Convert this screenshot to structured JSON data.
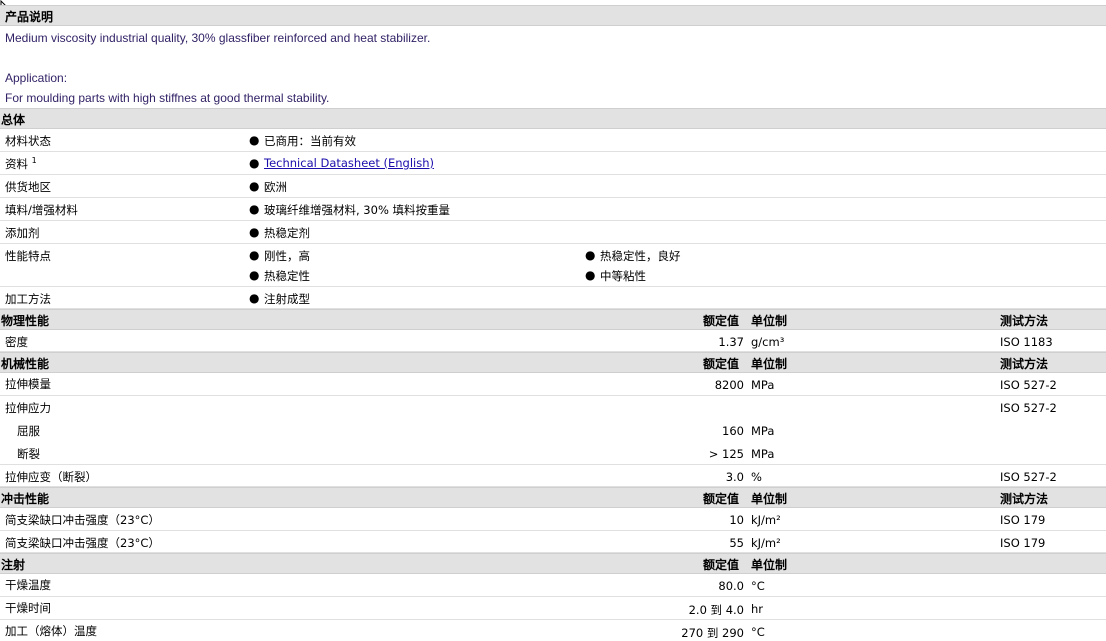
{
  "description": {
    "section_title": "产品说明",
    "line1": "Medium viscosity industrial quality, 30% glassfiber reinforced and heat stabilizer.",
    "line2": "Application:",
    "line3": "For moulding parts with high stiffnes at good thermal stability."
  },
  "general": {
    "section_title": "总体",
    "rows": [
      {
        "label": "材料状态",
        "value": "已商用：当前有效"
      },
      {
        "label": "资料",
        "sup": "1",
        "value": "Technical Datasheet (English)"
      },
      {
        "label": "供货地区",
        "value": "欧洲"
      },
      {
        "label": "填料/增强材料",
        "value": "玻璃纤维增强材料, 30% 填料按重量"
      },
      {
        "label": "添加剂",
        "value": "热稳定剂"
      },
      {
        "label": "性能特点",
        "values": [
          "刚性，高",
          "热稳定性，良好",
          "热稳定性",
          "中等粘性"
        ]
      },
      {
        "label": "加工方法",
        "value": "注射成型"
      }
    ]
  },
  "headers": {
    "nominal": "额定值",
    "unit": "单位制",
    "test": "测试方法"
  },
  "physical": {
    "section_title": "物理性能",
    "rows": [
      {
        "label": "密度",
        "value": "1.37",
        "unit": "g/cm³",
        "test": "ISO 1183"
      }
    ]
  },
  "mechanical": {
    "section_title": "机械性能",
    "rows": [
      {
        "label": "拉伸模量",
        "value": "8200",
        "unit": "MPa",
        "test": "ISO 527-2"
      },
      {
        "label": "拉伸应力",
        "value": "",
        "unit": "",
        "test": "ISO 527-2"
      },
      {
        "label": "屈服",
        "value": "160",
        "unit": "MPa",
        "test": ""
      },
      {
        "label": "断裂",
        "value": "> 125",
        "unit": "MPa",
        "test": ""
      },
      {
        "label": "拉伸应变（断裂）",
        "value": "3.0",
        "unit": "%",
        "test": "ISO 527-2"
      }
    ]
  },
  "impact": {
    "section_title": "冲击性能",
    "rows": [
      {
        "label": "简支梁缺口冲击强度（23°C）",
        "value": "10",
        "unit": "kJ/m²",
        "test": "ISO 179"
      },
      {
        "label": "简支梁缺口冲击强度（23°C）",
        "value": "55",
        "unit": "kJ/m²",
        "test": "ISO 179"
      }
    ]
  },
  "injection": {
    "section_title": "注射",
    "rows": [
      {
        "label": "干燥温度",
        "value": "80.0",
        "unit": "°C"
      },
      {
        "label": "干燥时间",
        "value": "2.0 到 4.0",
        "unit": "hr"
      },
      {
        "label": "加工（熔体）温度",
        "value": "270 到 290",
        "unit": "°C"
      }
    ]
  },
  "bullet_char": "●"
}
